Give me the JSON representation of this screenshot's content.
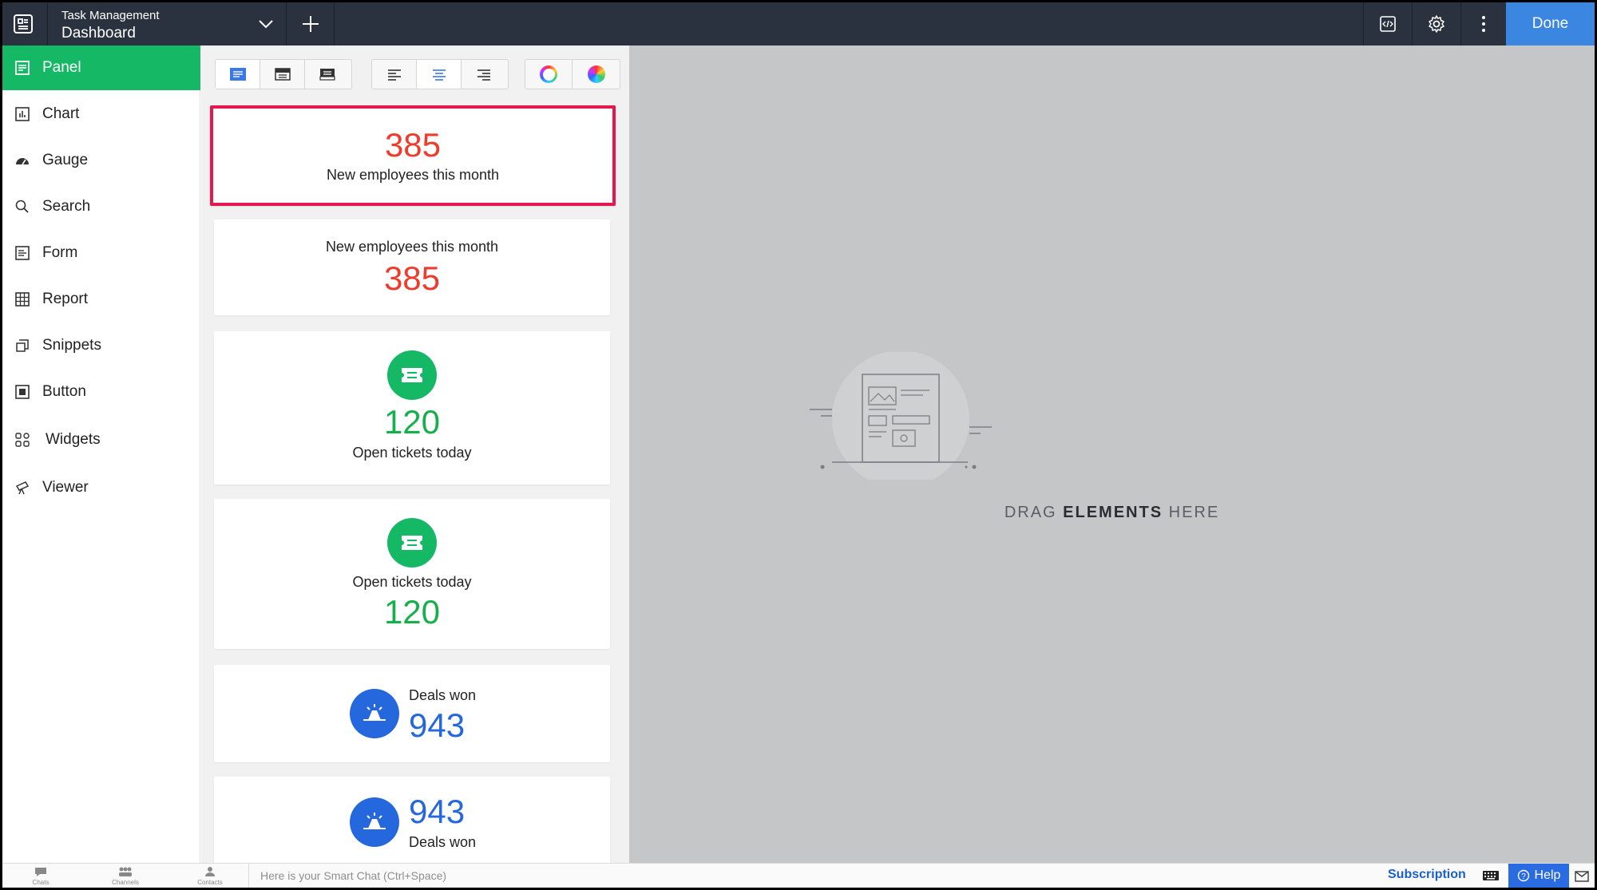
{
  "topbar": {
    "app_subtitle": "Task Management",
    "app_title": "Dashboard",
    "done_label": "Done",
    "accent": "#3b86e0",
    "background": "#2a3240"
  },
  "sidebar": {
    "active_color": "#14b865",
    "items": [
      {
        "label": "Panel",
        "icon": "panel-icon",
        "active": true
      },
      {
        "label": "Chart",
        "icon": "chart-icon"
      },
      {
        "label": "Gauge",
        "icon": "gauge-icon"
      },
      {
        "label": "Search",
        "icon": "search-icon"
      },
      {
        "label": "Form",
        "icon": "form-icon"
      },
      {
        "label": "Report",
        "icon": "report-icon"
      },
      {
        "label": "Snippets",
        "icon": "snippets-icon"
      },
      {
        "label": "Button",
        "icon": "button-icon"
      },
      {
        "label": "Widgets",
        "icon": "widgets-icon"
      },
      {
        "label": "Viewer",
        "icon": "viewer-icon"
      }
    ]
  },
  "palette": {
    "toolbar": {
      "layout_icons": [
        "layout-text-icon",
        "layout-header-icon",
        "layout-dark-icon"
      ],
      "align_icons": [
        "align-left-icon",
        "align-center-icon",
        "align-right-icon"
      ],
      "color_icons": [
        "color-ring-icon",
        "color-wheel-icon"
      ]
    },
    "cards": [
      {
        "value": "385",
        "label": "New employees this month",
        "color": "#ef3b2c"
      },
      {
        "label": "New employees this month",
        "value": "385",
        "color": "#ef3b2c"
      },
      {
        "value": "120",
        "label": "Open tickets today",
        "color": "#14b049",
        "icon": "ticket-icon"
      },
      {
        "label": "Open tickets today",
        "value": "120",
        "color": "#14b049",
        "icon": "ticket-icon"
      },
      {
        "label": "Deals won",
        "value": "943",
        "color": "#2567dc",
        "icon": "deal-icon"
      },
      {
        "value": "943",
        "label": "Deals won",
        "color": "#2567dc",
        "icon": "deal-icon"
      }
    ]
  },
  "canvas": {
    "drop_prefix": "DRAG ",
    "drop_bold": "ELEMENTS",
    "drop_suffix": " HERE"
  },
  "bottombar": {
    "tabs": [
      "Chats",
      "Channels",
      "Contacts"
    ],
    "chat_placeholder": "Here is your Smart Chat (Ctrl+Space)",
    "subscription_label": "Subscription",
    "help_label": "Help"
  }
}
